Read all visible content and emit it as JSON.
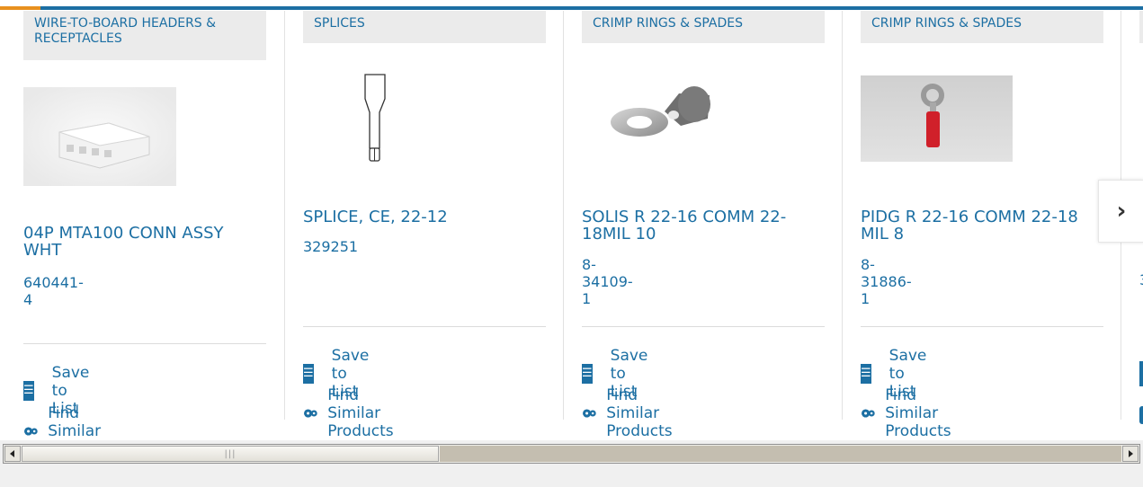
{
  "cards": [
    {
      "category": "WIRE-TO-BOARD HEADERS & RECEPTACLES",
      "title": "04P MTA100 CONN ASSY WHT",
      "part_number": "640441-4",
      "save_label": "Save to List",
      "similar_label": "Find Similar Products"
    },
    {
      "category": "SPLICES",
      "title": "SPLICE, CE, 22-12",
      "part_number": "329251",
      "save_label": "Save to List",
      "similar_label": "Find Similar Products"
    },
    {
      "category": "CRIMP RINGS & SPADES",
      "title": "SOLIS R 22-16 COMM 22-18MIL 10",
      "part_number": "8-34109-1",
      "save_label": "Save to List",
      "similar_label": "Find Similar Products"
    },
    {
      "category": "CRIMP RINGS & SPADES",
      "title": "PIDG R 22-16 COMM 22-18 MIL 8",
      "part_number": "8-31886-1",
      "save_label": "Save to List",
      "similar_label": "Find Similar Products"
    }
  ],
  "partial_card": {
    "part_number_fragment": "3"
  },
  "nav": {
    "next_glyph": "›"
  },
  "colors": {
    "link": "#1c6fa3",
    "accent": "#e8901e",
    "category_bg": "#ebebeb"
  },
  "icons": {
    "save": "checklist-icon",
    "similar": "gears-icon",
    "next": "chevron-right-icon"
  }
}
